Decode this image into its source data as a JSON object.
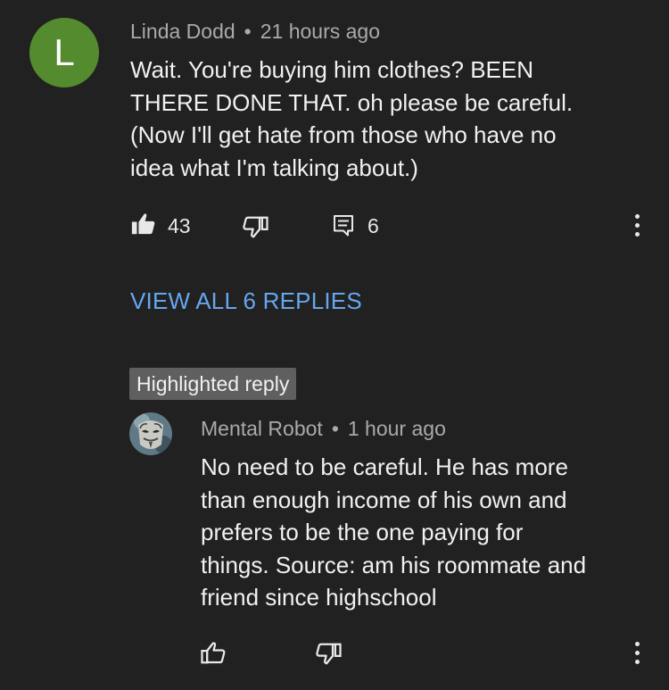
{
  "comment": {
    "avatar_letter": "L",
    "avatar_color": "#558b2f",
    "author": "Linda Dodd",
    "time": "21 hours ago",
    "text_lines": [
      "Wait.  You're buying him clothes?  BEEN",
      "THERE DONE THAT.  oh please be careful.",
      "(Now I'll get hate from those who have no",
      "idea what I'm talking about.)"
    ],
    "like_count": "43",
    "reply_count": "6",
    "icons": [
      "thumbs-up-filled-icon",
      "thumbs-down-icon",
      "reply-icon",
      "more-vert-icon"
    ]
  },
  "view_replies_label": "VIEW ALL 6 REPLIES",
  "view_replies_color": "#65a7ef",
  "highlighted_label": "Highlighted reply",
  "reply": {
    "author": "Mental Robot",
    "time": "1 hour ago",
    "text_lines": [
      "No need to be careful. He has more",
      "than enough income of his own and",
      "prefers to be the one paying for",
      "things. Source: am his roommate and",
      "friend since highschool"
    ],
    "icons": [
      "thumbs-up-icon",
      "thumbs-down-icon",
      "more-vert-icon"
    ]
  },
  "background_color": "#212121"
}
